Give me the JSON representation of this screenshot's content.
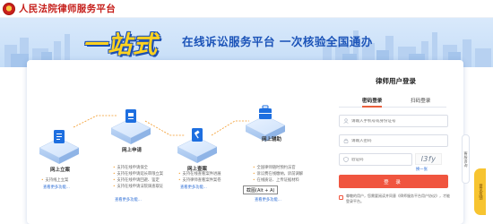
{
  "header": {
    "title": "人民法院律师服务平台"
  },
  "banner": {
    "slogan_big": "一站式",
    "slogan_small": "在线诉讼服务平台  一次核验全国通办"
  },
  "steps": [
    {
      "label": "网上立案",
      "features": [
        "支持线上立案",
        "查看更多功能..."
      ]
    },
    {
      "label": "网上申请",
      "features": [
        "支持在线申请保全",
        "支持在线申请延长审限立案",
        "支持在线申请回避、鉴定",
        "支持在线申请法院调查取证"
      ],
      "more": "查看更多功能..."
    },
    {
      "label": "网上查案",
      "features": [
        "支持在线查看案件进展",
        "支持律师查看案件案卷",
        "查看更多功能..."
      ]
    },
    {
      "label": "网上辅助",
      "features": [
        "全国律师随时预约法官",
        "诉讼费在线缴纳，诉前调解",
        "在线质证、上传证据材料"
      ],
      "more": "查看更多功能..."
    }
  ],
  "login": {
    "title": "律师用户登录",
    "tabs": [
      {
        "label": "密码登录",
        "active": true
      },
      {
        "label": "扫码登录",
        "active": false
      }
    ],
    "phone_placeholder": "请输入手机号或身份证号",
    "password_placeholder": "请输入密码",
    "captcha_placeholder": "验证码",
    "captcha_text": "l3fy",
    "captcha_refresh": "换一张",
    "button": "登 录",
    "agreement_text": "尊敬的用户，您需要阅读并同意《律师服务平台用户协议》，才能登录平台。",
    "agreement_link": "《律师服务平台用户协议》"
  },
  "tooltip": {
    "text": "截图(Alt + A)"
  },
  "float": {
    "label": "客服咨询"
  },
  "feedback": {
    "label": "意见反馈"
  },
  "colors": {
    "accent": "#f0553f",
    "brand_red": "#c51e1a",
    "link_blue": "#2f6fd6",
    "icon_blue": "#1e6fe0"
  }
}
